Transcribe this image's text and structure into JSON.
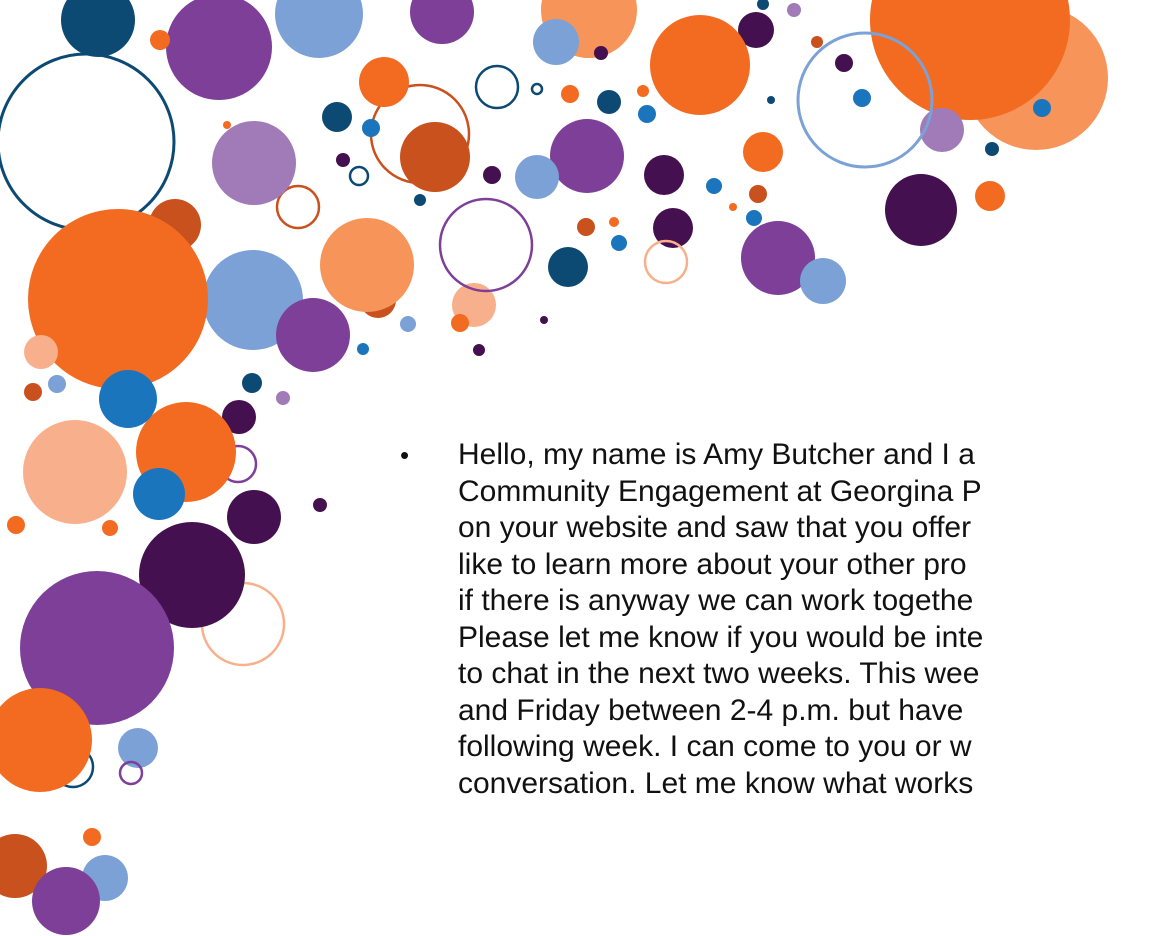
{
  "slide": {
    "bullet_symbol": "•",
    "body_lines": [
      "Hello, my name is Amy Butcher and I a",
      "Community Engagement at Georgina P",
      "on your website and saw that you offer",
      "like to learn more about your other pro",
      "if there is anyway we can work togethe",
      "Please let me know if you would be inte",
      "to chat in the next two weeks. This wee",
      "and Friday between 2-4 p.m. but have",
      "following week. I can come to you or w",
      "conversation. Let me know what works"
    ]
  },
  "colors": {
    "orange": "#F26B21",
    "light_orange": "#F6945A",
    "peach": "#F8B08C",
    "purple": "#7D3F98",
    "light_purple": "#A07BB8",
    "dark_purple": "#44104F",
    "blue": "#1B75BC",
    "light_blue": "#7BA1D6",
    "navy": "#0D4A73",
    "rust": "#C8511E"
  }
}
